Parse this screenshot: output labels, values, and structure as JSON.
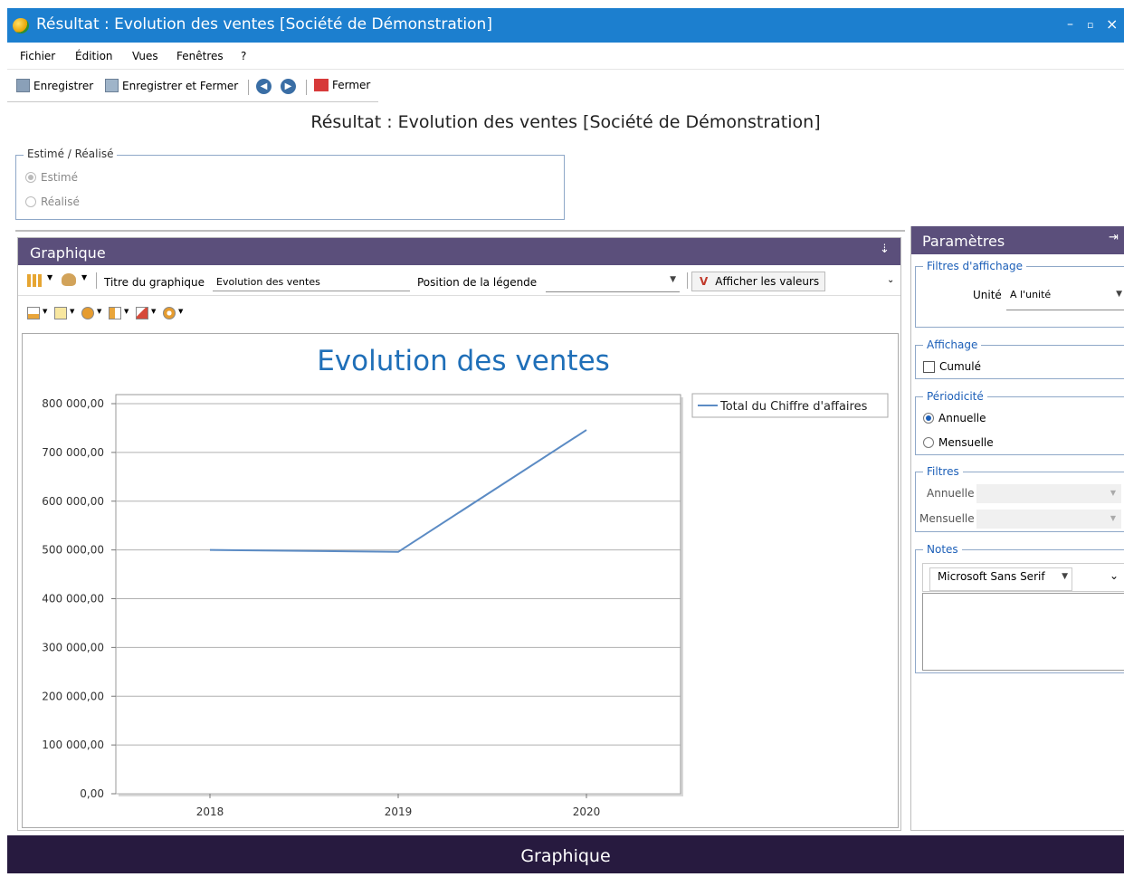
{
  "window": {
    "title": "Résultat : Evolution des ventes [Société de Démonstration]",
    "minimize": "–",
    "maximize": "▫",
    "close": "×"
  },
  "menu": [
    "Fichier",
    "Édition",
    "Vues",
    "Fenêtres",
    "?"
  ],
  "toolbar": {
    "save_label": "Enregistrer",
    "save_close_label": "Enregistrer et Fermer",
    "close_label": "Fermer"
  },
  "page_title": "Résultat : Evolution des ventes [Société de Démonstration]",
  "estime_group": {
    "legend": "Estimé / Réalisé",
    "options": [
      "Estimé",
      "Réalisé"
    ],
    "selected": "Estimé"
  },
  "graph_panel": {
    "header": "Graphique",
    "title_label": "Titre du graphique",
    "title_value": "Evolution des ventes",
    "legend_position_label": "Position de la légende",
    "legend_position_value": "",
    "show_values_label": "Afficher les valeurs",
    "show_values_mark": "V"
  },
  "chart_data": {
    "type": "line",
    "title": "Evolution des ventes",
    "categories": [
      "2018",
      "2019",
      "2020"
    ],
    "series": [
      {
        "name": "Total du Chiffre d'affaires",
        "values": [
          500000,
          496000,
          746000
        ],
        "color": "#5b8bc4"
      }
    ],
    "ylim": [
      0,
      800000
    ],
    "yticks": [
      "0,00",
      "100 000,00",
      "200 000,00",
      "300 000,00",
      "400 000,00",
      "500 000,00",
      "600 000,00",
      "700 000,00",
      "800 000,00"
    ],
    "xlabel": "",
    "ylabel": "",
    "grid": true,
    "legend_position": "right",
    "title_color": "#1f6fb8"
  },
  "params_panel": {
    "header": "Paramètres",
    "filtres_affichage": {
      "legend": "Filtres d'affichage",
      "unit_label": "Unité",
      "unit_value": "A l'unité"
    },
    "affichage": {
      "legend": "Affichage",
      "cumule_label": "Cumulé",
      "cumule_checked": false
    },
    "periodicite": {
      "legend": "Périodicité",
      "options": [
        "Annuelle",
        "Mensuelle"
      ],
      "selected": "Annuelle"
    },
    "filtres": {
      "legend": "Filtres",
      "annuelle_label": "Annuelle",
      "mensuelle_label": "Mensuelle"
    },
    "notes": {
      "legend": "Notes",
      "font_value": "Microsoft Sans Serif"
    }
  },
  "status": {
    "label": "Graphique"
  },
  "colors": {
    "titlebar": "#1c7fcf",
    "panel_header": "#5b4f7b",
    "statusbar": "#271a3f"
  }
}
